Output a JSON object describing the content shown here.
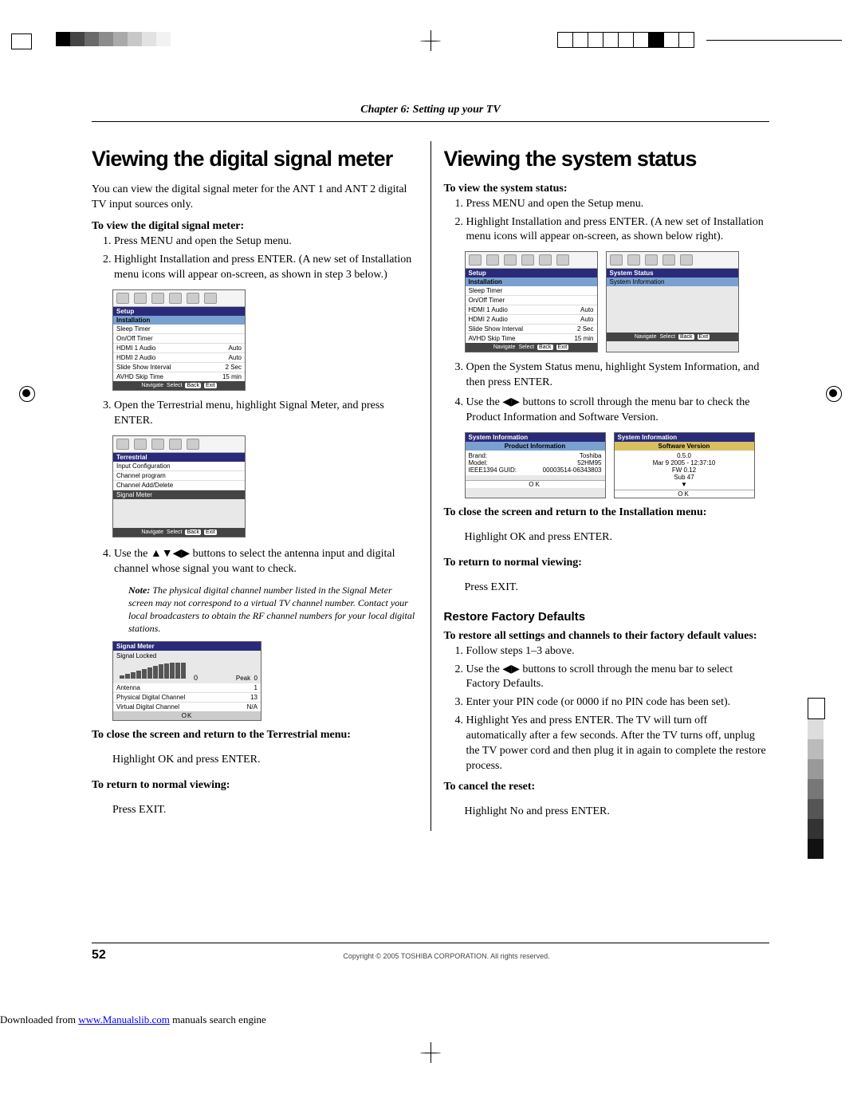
{
  "chapter": "Chapter 6: Setting up your TV",
  "left": {
    "heading": "Viewing the digital signal meter",
    "intro": "You can view the digital signal meter for the ANT 1 and ANT 2 digital TV input sources only.",
    "to_view_h": "To view the digital signal meter:",
    "steps_a": [
      "Press MENU and open the Setup menu.",
      "Highlight Installation and press ENTER. (A new set of Installation menu icons will appear on-screen, as shown in step 3 below.)"
    ],
    "osd1": {
      "title": "Setup",
      "sub": "Installation",
      "rows": [
        {
          "l": "Sleep Timer",
          "r": ""
        },
        {
          "l": "On/Off Timer",
          "r": ""
        },
        {
          "l": "HDMI 1 Audio",
          "r": "Auto"
        },
        {
          "l": "HDMI 2 Audio",
          "r": "Auto"
        },
        {
          "l": "Slide Show Interval",
          "r": "2 Sec"
        },
        {
          "l": "AVHD Skip Time",
          "r": "15 min"
        }
      ],
      "hint": [
        "Navigate",
        "Select",
        "Back",
        "Exit"
      ]
    },
    "step3": "Open the Terrestrial menu, highlight Signal Meter, and press ENTER.",
    "osd2": {
      "title": "Terrestrial",
      "rows": [
        "Input Configuration",
        "Channel program",
        "Channel Add/Delete",
        "Signal Meter"
      ],
      "hint": [
        "Navigate",
        "Select",
        "Back",
        "Exit"
      ]
    },
    "step4_pre": "Use the ",
    "step4_arrows": "▲▼◀▶",
    "step4_post": " buttons to select the antenna input and digital channel whose signal you want to check.",
    "note_label": "Note:",
    "note": " The physical digital channel number listed in the Signal Meter screen may not correspond to a virtual TV channel number. Contact your local broadcasters to obtain the RF channel numbers for your local digital stations.",
    "osd3": {
      "title": "Signal Meter",
      "locked": "Signal Locked",
      "zero": "0",
      "peak_l": "Peak",
      "peak_v": "0",
      "rows": [
        {
          "l": "Antenna",
          "r": "1"
        },
        {
          "l": "Physical Digital Channel",
          "r": "13"
        },
        {
          "l": "Virtual Digital Channel",
          "r": "N/A"
        }
      ],
      "ok": "OK"
    },
    "close_h": "To close the screen and return to the Terrestrial menu:",
    "close_body": "Highlight OK and press ENTER.",
    "return_h": "To return to normal viewing:",
    "return_body": "Press EXIT."
  },
  "right": {
    "heading": "Viewing the system status",
    "to_view_h": "To view the system status:",
    "steps_a": [
      "Press MENU and open the Setup menu.",
      "Highlight Installation and press ENTER. (A new set of Installation menu icons will appear on-screen, as shown below right)."
    ],
    "osdL": {
      "title": "Setup",
      "sub": "Installation",
      "rows": [
        {
          "l": "Sleep Timer",
          "r": ""
        },
        {
          "l": "On/Off Timer",
          "r": ""
        },
        {
          "l": "HDMI 1 Audio",
          "r": "Auto"
        },
        {
          "l": "HDMI 2 Audio",
          "r": "Auto"
        },
        {
          "l": "Slide Show Interval",
          "r": "2 Sec"
        },
        {
          "l": "AVHD Skip Time",
          "r": "15 min"
        }
      ],
      "hint": [
        "Navigate",
        "Select",
        "Back",
        "Exit"
      ]
    },
    "osdR": {
      "title": "System Status",
      "row": "System Information",
      "hint": [
        "Navigate",
        "Select",
        "Back",
        "Exit"
      ]
    },
    "step3": "Open the System Status menu, highlight System Information, and then press ENTER.",
    "step4_pre": "Use the ",
    "step4_arrows": "◀▶",
    "step4_post": " buttons to scroll through the menu bar to check the Product Information and Software Version.",
    "osd3L": {
      "title": "System Information",
      "sub": "Product Information",
      "rows": [
        {
          "l": "Brand:",
          "r": "Toshiba"
        },
        {
          "l": "Model:",
          "r": "52HM95"
        },
        {
          "l": "IEEE1394 GUID:",
          "r": "00003514-06343803"
        }
      ],
      "ok": "OK"
    },
    "osd3R": {
      "title": "System Information",
      "sub": "Software Version",
      "rows": [
        "0.5.0",
        "Mar 9 2005 - 12:37:10",
        "FW 0.12",
        "Sub 47"
      ],
      "ok": "OK"
    },
    "close_h": "To close the screen and return to the Installation menu:",
    "close_body": "Highlight OK and press ENTER.",
    "return_h": "To return to normal viewing:",
    "return_body": "Press EXIT.",
    "restore_h": "Restore Factory Defaults",
    "restore_sub_h": "To restore all settings and channels to their factory default values:",
    "restore_steps": [
      "Follow steps 1–3 above.",
      "Use the ◀▶ buttons to scroll through the menu bar to select Factory Defaults.",
      "Enter your PIN code (or 0000 if no PIN code has been set).",
      "Highlight Yes and press ENTER. The TV will turn off automatically after a few seconds. After the TV turns off, unplug the TV power cord and then plug it in again to complete the restore process."
    ],
    "cancel_h": "To cancel the reset:",
    "cancel_body": "Highlight No and press ENTER."
  },
  "footer": {
    "page": "52",
    "copyright": "Copyright © 2005 TOSHIBA CORPORATION. All rights reserved."
  },
  "download": {
    "pre": "Downloaded from ",
    "link": "www.Manualslib.com",
    "post": " manuals search engine"
  }
}
